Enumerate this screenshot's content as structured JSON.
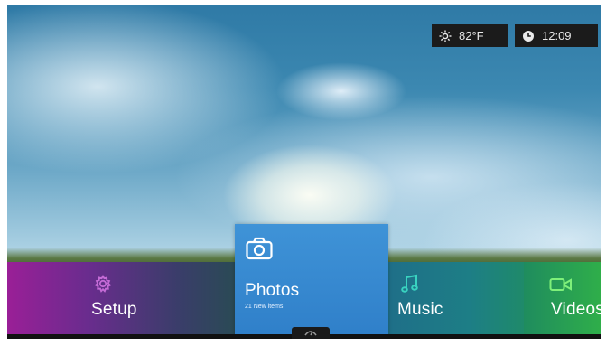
{
  "status": {
    "temperature": "82°F",
    "time": "12:09"
  },
  "menu": {
    "setup": {
      "label": "Setup"
    },
    "photos": {
      "label": "Photos",
      "subtitle": "21 New items"
    },
    "music": {
      "label": "Music"
    },
    "videos": {
      "label": "Videos"
    }
  },
  "colors": {
    "photos_tile": "#3a8ad3",
    "setup_tile": "#9a1f97",
    "music_tile": "#1f6f88",
    "videos_tile": "#2fae4a",
    "status_bg": "#1b1b1b"
  },
  "icons": {
    "weather": "sun-icon",
    "clock": "clock-icon",
    "setup": "gear-icon",
    "photos": "camera-icon",
    "music": "music-note-icon",
    "videos": "video-camera-icon",
    "handle": "chevron-up-icon"
  }
}
